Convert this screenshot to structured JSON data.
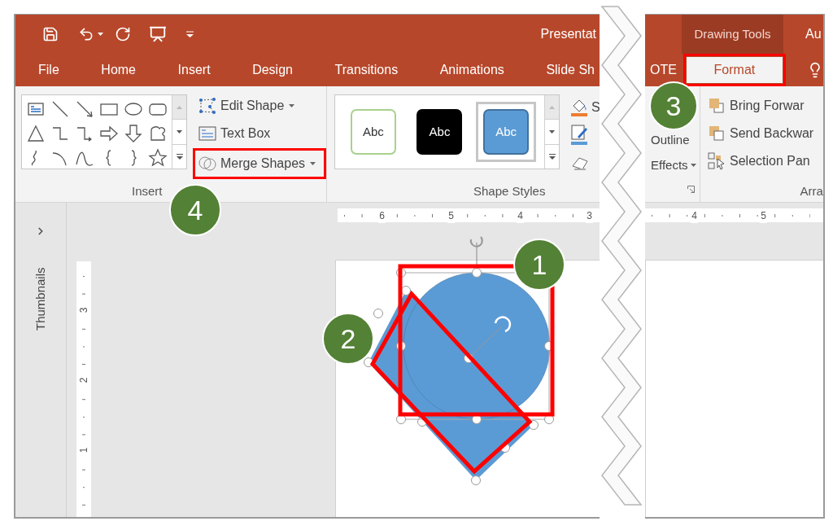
{
  "title_bar": {
    "title": "Presentat",
    "context_tab_group": "Drawing Tools",
    "account": "Au"
  },
  "tabs": {
    "before_break": [
      {
        "label": "File",
        "selected": false,
        "highlighted": false
      },
      {
        "label": "Home",
        "selected": false,
        "highlighted": false
      },
      {
        "label": "Insert",
        "selected": false,
        "highlighted": false
      },
      {
        "label": "Design",
        "selected": false,
        "highlighted": false
      },
      {
        "label": "Transitions",
        "selected": false,
        "highlighted": false
      },
      {
        "label": "Animations",
        "selected": false,
        "highlighted": false
      },
      {
        "label": "Slide Sh",
        "selected": false,
        "highlighted": false
      }
    ],
    "after_break": [
      {
        "label": "OTE",
        "selected": false,
        "highlighted": false
      },
      {
        "label": "Format",
        "selected": true,
        "highlighted": true
      }
    ]
  },
  "ribbon": {
    "insert_shapes": {
      "commands": [
        {
          "label": "Edit Shape",
          "dropdown": true,
          "highlighted": false
        },
        {
          "label": "Text Box",
          "dropdown": false,
          "highlighted": false
        },
        {
          "label": "Merge Shapes",
          "dropdown": true,
          "highlighted": true
        }
      ],
      "group_label": "Insert"
    },
    "shape_styles": {
      "swatches": [
        {
          "label": "Abc",
          "kind": "outline",
          "selected": false
        },
        {
          "label": "Abc",
          "kind": "dark",
          "selected": false
        },
        {
          "label": "Abc",
          "kind": "blue",
          "selected": true
        }
      ],
      "fill_label": "S",
      "outline_label": "Outline",
      "effects_label": "Effects",
      "group_label": "Shape Styles"
    },
    "arrange": {
      "commands": [
        "Bring Forwar",
        "Send Backwar",
        "Selection Pan"
      ],
      "group_label": "Arra"
    }
  },
  "thumbnails_pane": {
    "label": "Thumbnails"
  },
  "rulers": {
    "horizontal_before_break": [
      "6",
      "5",
      "4",
      "3"
    ],
    "horizontal_after_break": [
      "4",
      "5"
    ],
    "vertical": [
      "3",
      "2",
      "1"
    ]
  },
  "slide_shapes": [
    {
      "kind": "rectangle",
      "highlighted": true
    },
    {
      "kind": "circle",
      "highlighted": true
    }
  ],
  "callouts": [
    "1",
    "2",
    "3",
    "4"
  ]
}
